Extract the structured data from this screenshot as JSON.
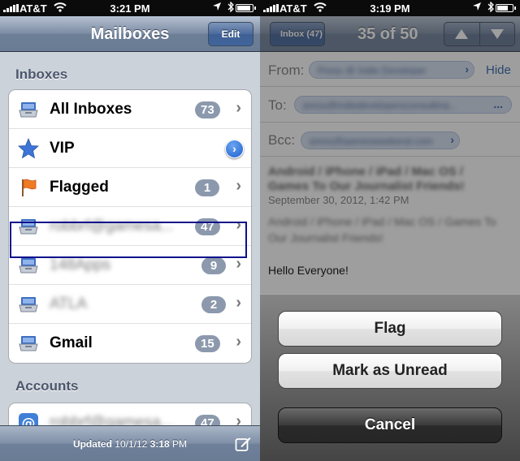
{
  "left": {
    "status": {
      "carrier": "AT&T",
      "time": "3:21 PM"
    },
    "nav": {
      "title": "Mailboxes",
      "edit_label": "Edit"
    },
    "inboxes": {
      "header": "Inboxes",
      "items": [
        {
          "label": "All Inboxes",
          "badge": "73",
          "icon": "inbox-tray-icon"
        },
        {
          "label": "VIP",
          "badge": "",
          "icon": "star-icon"
        },
        {
          "label": "Flagged",
          "badge": "1",
          "icon": "flag-icon"
        },
        {
          "label": "robbrf@gamesa...",
          "badge": "47",
          "icon": "inbox-tray-icon"
        },
        {
          "label": "148Apps",
          "badge": "9",
          "icon": "inbox-tray-icon"
        },
        {
          "label": "ATLA",
          "badge": "2",
          "icon": "inbox-tray-icon"
        },
        {
          "label": "Gmail",
          "badge": "15",
          "icon": "inbox-tray-icon"
        }
      ]
    },
    "accounts": {
      "header": "Accounts",
      "items": [
        {
          "label": "robbrf@gamesa...",
          "badge": "47",
          "icon": "at-sign-icon"
        }
      ]
    },
    "toolbar": {
      "updated_label": "Updated",
      "updated_date": "10/1/12",
      "updated_time": "3:18",
      "updated_ampm": "PM"
    }
  },
  "right": {
    "status": {
      "carrier": "AT&T",
      "time": "3:19 PM"
    },
    "nav": {
      "back_label": "Inbox (47)",
      "counter": "35 of 50"
    },
    "header": {
      "from_label": "From:",
      "from_value": "Press @ Indie Developer",
      "hide_label": "Hide",
      "to_label": "To:",
      "to_value": "press@indiedevelopersconsulting...",
      "to_more": "...",
      "bcc_label": "Bcc:",
      "bcc_value": "press@gamesweekend.com"
    },
    "message": {
      "subject": "Android / iPhone / iPad / Mac OS / Games To Our Journalist Friends!",
      "date": "September 30, 2012, 1:42 PM",
      "preview": "Android / iPhone / iPad / Mac OS / Games To Our Journalist Friends!",
      "greeting": "Hello Everyone!"
    },
    "action_sheet": {
      "flag_label": "Flag",
      "unread_label": "Mark as Unread",
      "cancel_label": "Cancel"
    }
  },
  "colors": {
    "badge": "#8c99ad",
    "highlight": "#0d108c",
    "nav_tint": "#6d7e97",
    "link": "#2d5fa8"
  }
}
